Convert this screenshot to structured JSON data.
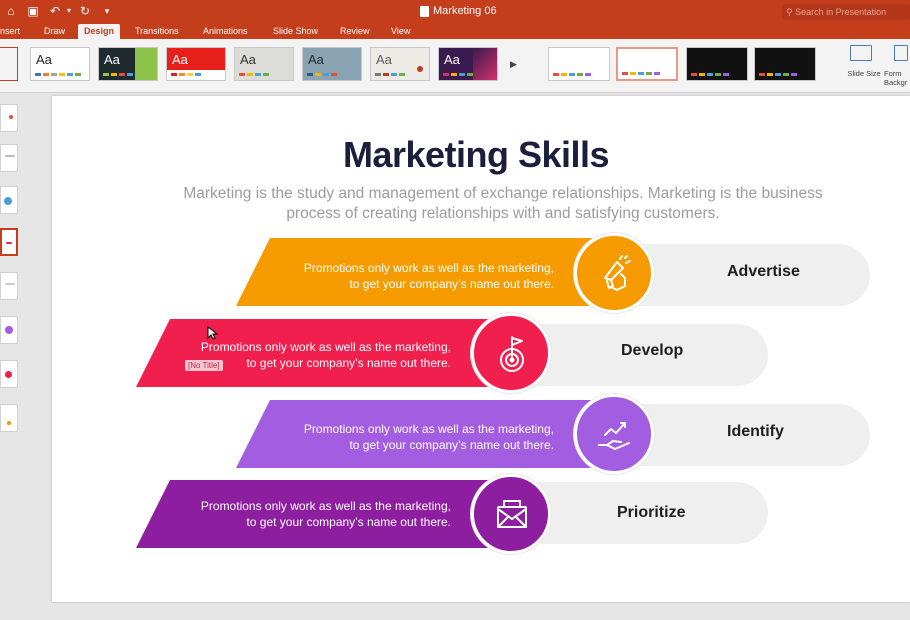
{
  "app": {
    "document_title": "Marketing 06",
    "search_placeholder": "Search in Presentation"
  },
  "tabs": [
    {
      "label": "nsert",
      "active": false
    },
    {
      "label": "Draw",
      "active": false
    },
    {
      "label": "Design",
      "active": true
    },
    {
      "label": "Transitions",
      "active": false
    },
    {
      "label": "Animations",
      "active": false
    },
    {
      "label": "Slide Show",
      "active": false
    },
    {
      "label": "Review",
      "active": false
    },
    {
      "label": "View",
      "active": false
    }
  ],
  "ribbon": {
    "themes": [
      {
        "aa": "Aa",
        "bg": "#ffffff",
        "fg": "#222222",
        "selected": false
      },
      {
        "aa": "Aa",
        "bg": "#1f2a2e",
        "fg": "#ffffff",
        "selected": false
      },
      {
        "aa": "Aa",
        "bg": "#e8201c",
        "fg": "#ffffff",
        "selected": false
      },
      {
        "aa": "Aa",
        "bg": "#dcdcd8",
        "fg": "#333333",
        "selected": false
      },
      {
        "aa": "Aa",
        "bg": "#8aa3b3",
        "fg": "#1e2a33",
        "selected": false
      },
      {
        "aa": "Aa",
        "bg": "#ecebe6",
        "fg": "#5d5d5d",
        "selected": false
      },
      {
        "aa": "Aa",
        "bg": "#3a1a4f",
        "fg": "#ffffff",
        "selected": false
      }
    ],
    "variants": [
      {
        "bg": "#ffffff",
        "selected": false
      },
      {
        "bg": "#ffffff",
        "selected": true
      },
      {
        "bg": "#111111",
        "selected": false
      },
      {
        "bg": "#111111",
        "selected": false
      }
    ],
    "slide_size_label": "Slide Size",
    "format_background_label": "Form Backgr"
  },
  "slide": {
    "title": "Marketing Skills",
    "subtitle_line1": "Marketing is the study and management of exchange relationships. Marketing is the business",
    "subtitle_line2": "process of creating relationships with and satisfying customers.",
    "rows": [
      {
        "label": "Advertise",
        "text1": "Promotions only work as well as the marketing,",
        "text2": "to get your company’s name out there.",
        "color": "#f59b00",
        "icon": "megaphone-hand-icon"
      },
      {
        "label": "Develop",
        "text1": "Promotions only work as well as the marketing,",
        "text2": "to get your company’s name out there.",
        "color": "#f01f4e",
        "icon": "target-flag-icon"
      },
      {
        "label": "Identify",
        "text1": "Promotions only work as well as the marketing,",
        "text2": "to get your company’s name out there.",
        "color": "#a35de0",
        "icon": "growth-hand-icon"
      },
      {
        "label": "Prioritize",
        "text1": "Promotions only work as well as the marketing,",
        "text2": "to get your company’s name out there.",
        "color": "#8e1ea0",
        "icon": "envelope-icon"
      }
    ],
    "placeholder_tag": "[No Title]"
  }
}
